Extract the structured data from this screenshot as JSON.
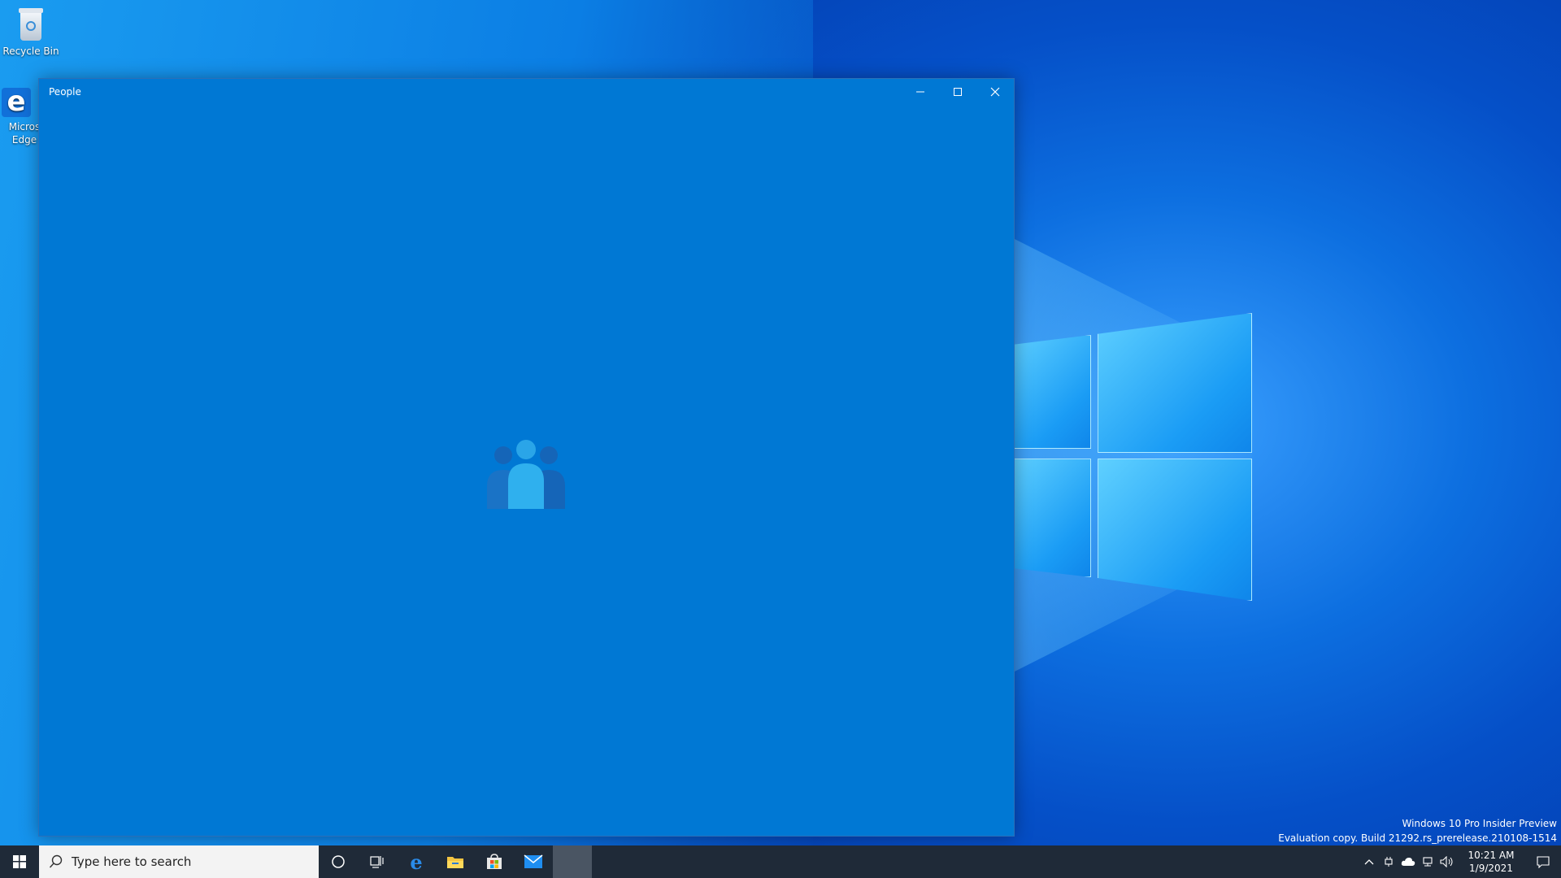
{
  "desktop": {
    "icons": [
      {
        "label": "Recycle Bin"
      },
      {
        "label": "Micros Edge"
      }
    ]
  },
  "window": {
    "title": "People"
  },
  "taskbar": {
    "search_placeholder": "Type here to search",
    "apps": [
      "cortana-icon",
      "task-view-icon",
      "edge-icon",
      "file-explorer-icon",
      "store-icon",
      "mail-icon",
      "people-app-icon"
    ],
    "clock_time": "10:21 AM",
    "clock_date": "1/9/2021"
  },
  "watermark": {
    "line1": "Windows 10 Pro Insider Preview",
    "line2": "Evaluation copy. Build 21292.rs_prerelease.210108-1514"
  },
  "colors": {
    "window_bg": "#0078d4",
    "taskbar_bg": "#1f2a38"
  }
}
